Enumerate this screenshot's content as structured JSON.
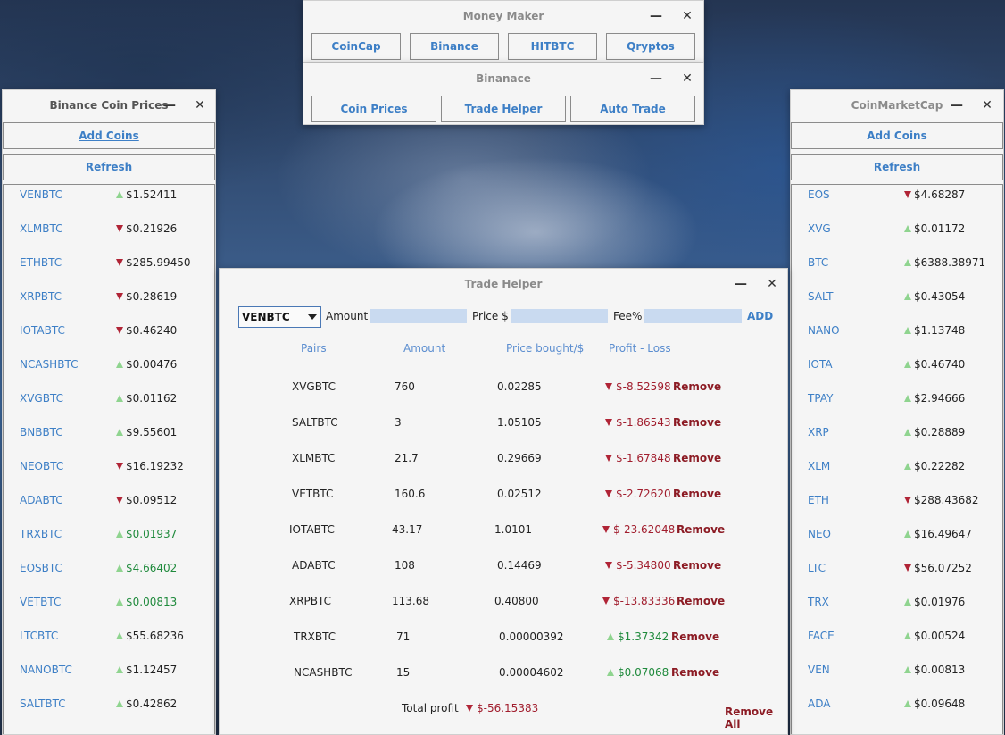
{
  "money_maker": {
    "title": "Money Maker",
    "buttons": [
      "CoinCap",
      "Binance",
      "HITBTC",
      "Qryptos"
    ]
  },
  "binanace": {
    "title": "Binanace",
    "buttons": [
      "Coin Prices",
      "Trade Helper",
      "Auto Trade"
    ]
  },
  "window_controls": {
    "minimize": "—",
    "close": "✕"
  },
  "binance_prices": {
    "title": "Binance Coin Prices",
    "add_label": "Add Coins",
    "refresh_label": "Refresh",
    "coins": [
      {
        "name": "VENBTC",
        "dir": "up",
        "price": "$1.52411",
        "highlight": false
      },
      {
        "name": "XLMBTC",
        "dir": "down",
        "price": "$0.21926",
        "highlight": false
      },
      {
        "name": "ETHBTC",
        "dir": "down",
        "price": "$285.99450",
        "highlight": false
      },
      {
        "name": "XRPBTC",
        "dir": "down",
        "price": "$0.28619",
        "highlight": false
      },
      {
        "name": "IOTABTC",
        "dir": "down",
        "price": "$0.46240",
        "highlight": false
      },
      {
        "name": "NCASHBTC",
        "dir": "up",
        "price": "$0.00476",
        "highlight": false
      },
      {
        "name": "XVGBTC",
        "dir": "up",
        "price": "$0.01162",
        "highlight": false
      },
      {
        "name": "BNBBTC",
        "dir": "up",
        "price": "$9.55601",
        "highlight": false
      },
      {
        "name": "NEOBTC",
        "dir": "down",
        "price": "$16.19232",
        "highlight": false
      },
      {
        "name": "ADABTC",
        "dir": "down",
        "price": "$0.09512",
        "highlight": false
      },
      {
        "name": "TRXBTC",
        "dir": "up",
        "price": "$0.01937",
        "highlight": true
      },
      {
        "name": "EOSBTC",
        "dir": "up",
        "price": "$4.66402",
        "highlight": true
      },
      {
        "name": "VETBTC",
        "dir": "up",
        "price": "$0.00813",
        "highlight": true
      },
      {
        "name": "LTCBTC",
        "dir": "up",
        "price": "$55.68236",
        "highlight": false
      },
      {
        "name": "NANOBTC",
        "dir": "up",
        "price": "$1.12457",
        "highlight": false
      },
      {
        "name": "SALTBTC",
        "dir": "up",
        "price": "$0.42862",
        "highlight": false
      }
    ]
  },
  "coinmarketcap": {
    "title": "CoinMarketCap",
    "add_label": "Add Coins",
    "refresh_label": "Refresh",
    "coins": [
      {
        "name": "EOS",
        "dir": "down",
        "price": "$4.68287"
      },
      {
        "name": "XVG",
        "dir": "up",
        "price": "$0.01172"
      },
      {
        "name": "BTC",
        "dir": "up",
        "price": "$6388.38971"
      },
      {
        "name": "SALT",
        "dir": "up",
        "price": "$0.43054"
      },
      {
        "name": "NANO",
        "dir": "up",
        "price": "$1.13748"
      },
      {
        "name": "IOTA",
        "dir": "up",
        "price": "$0.46740"
      },
      {
        "name": "TPAY",
        "dir": "up",
        "price": "$2.94666"
      },
      {
        "name": "XRP",
        "dir": "up",
        "price": "$0.28889"
      },
      {
        "name": "XLM",
        "dir": "up",
        "price": "$0.22282"
      },
      {
        "name": "ETH",
        "dir": "down",
        "price": "$288.43682"
      },
      {
        "name": "NEO",
        "dir": "up",
        "price": "$16.49647"
      },
      {
        "name": "LTC",
        "dir": "down",
        "price": "$56.07252"
      },
      {
        "name": "TRX",
        "dir": "up",
        "price": "$0.01976"
      },
      {
        "name": "FACE",
        "dir": "up",
        "price": "$0.00524"
      },
      {
        "name": "VEN",
        "dir": "up",
        "price": "$0.00813"
      },
      {
        "name": "ADA",
        "dir": "up",
        "price": "$0.09648"
      }
    ]
  },
  "trade_helper": {
    "title": "Trade Helper",
    "selected_pair": "VENBTC",
    "amount_label": "Amount",
    "amount_value": "",
    "price_label": "Price $",
    "price_value": "",
    "fee_label": "Fee%",
    "fee_value": "",
    "add_label": "ADD",
    "headers": [
      "Pairs",
      "Amount",
      "Price bought/$",
      "Profit - Loss"
    ],
    "remove_label": "Remove",
    "rows": [
      {
        "pair": "XVGBTC",
        "amount": "760",
        "price": "0.02285",
        "dir": "down",
        "pl": "$-8.52598"
      },
      {
        "pair": "SALTBTC",
        "amount": "3",
        "price": "1.05105",
        "dir": "down",
        "pl": "$-1.86543"
      },
      {
        "pair": "XLMBTC",
        "amount": "21.7",
        "price": "0.29669",
        "dir": "down",
        "pl": "$-1.67848"
      },
      {
        "pair": "VETBTC",
        "amount": "160.6",
        "price": "0.02512",
        "dir": "down",
        "pl": "$-2.72620"
      },
      {
        "pair": "IOTABTC",
        "amount": "43.17",
        "price": "1.0101",
        "dir": "down",
        "pl": "$-23.62048"
      },
      {
        "pair": "ADABTC",
        "amount": "108",
        "price": "0.14469",
        "dir": "down",
        "pl": "$-5.34800"
      },
      {
        "pair": "XRPBTC",
        "amount": "113.68",
        "price": "0.40800",
        "dir": "down",
        "pl": "$-13.83336"
      },
      {
        "pair": "TRXBTC",
        "amount": "71",
        "price": "0.00000392",
        "dir": "up",
        "pl": "$1.37342"
      },
      {
        "pair": "NCASHBTC",
        "amount": "15",
        "price": "0.00004602",
        "dir": "up",
        "pl": "$0.07068"
      }
    ],
    "total_label": "Total profit",
    "total_dir": "down",
    "total_value": "$-56.15383",
    "remove_all_label": "Remove All"
  }
}
